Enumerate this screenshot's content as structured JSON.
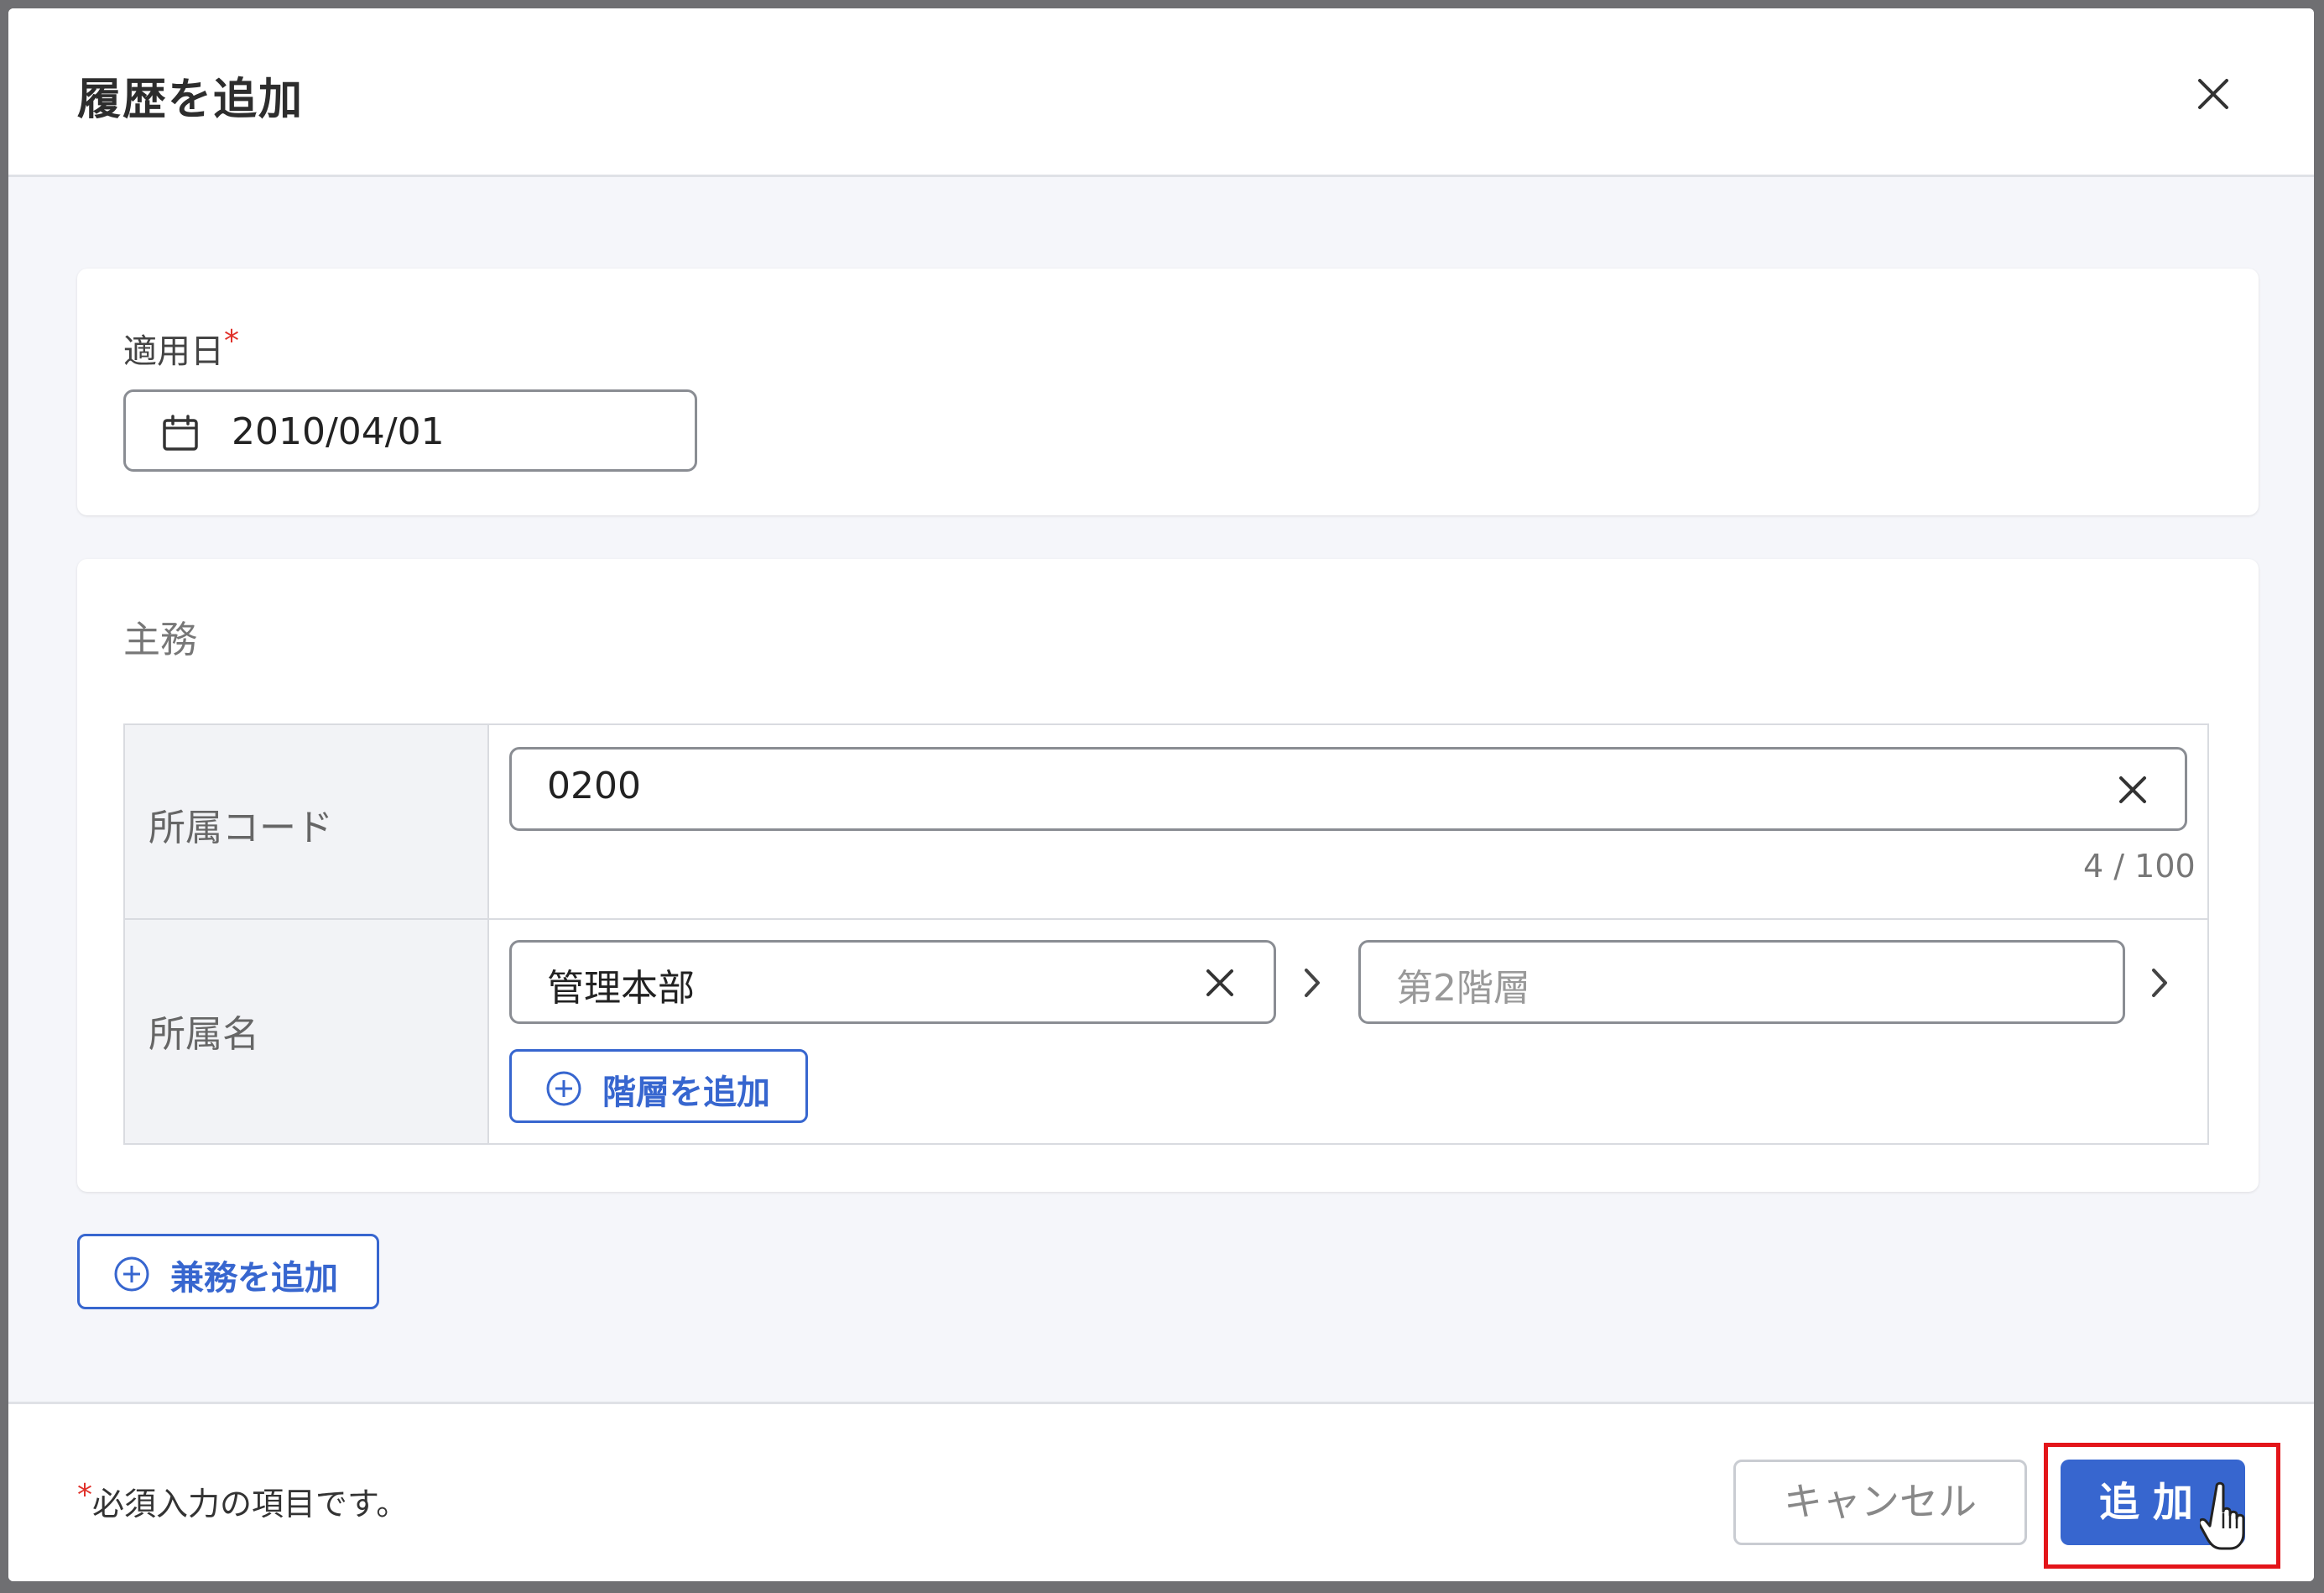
{
  "dialog": {
    "title": "履歴を追加",
    "close_icon": "close-icon"
  },
  "effective_date": {
    "label": "適用日",
    "required_mark": "*",
    "icon": "calendar-icon",
    "value": "2010/04/01"
  },
  "primary": {
    "section_title": "主務",
    "affiliation_code": {
      "label": "所属コード",
      "value": "0200",
      "counter": "4 / 100"
    },
    "affiliation_name": {
      "label": "所属名",
      "level1_value": "管理本部",
      "level2_placeholder": "第2階層",
      "add_level_label": "階層を追加"
    }
  },
  "add_concurrent_label": "兼務を追加",
  "footer": {
    "required_mark": "*",
    "required_note": "必須入力の項目です。",
    "cancel_label": "キャンセル",
    "add_label": "追加"
  },
  "colors": {
    "primary": "#3766cf",
    "required": "#e0312a",
    "highlight": "#e3151a"
  }
}
